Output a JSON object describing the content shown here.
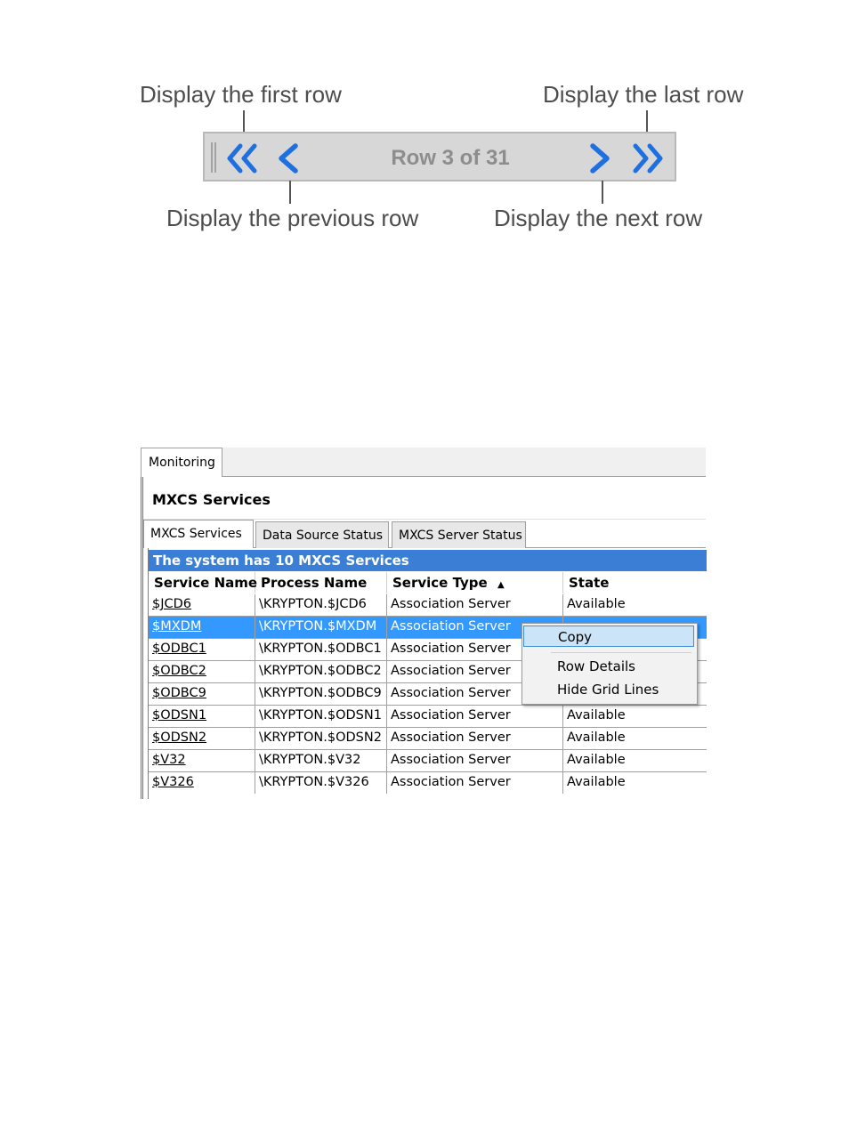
{
  "callouts": {
    "first": "Display the first row",
    "last": "Display the last row",
    "previous": "Display the previous row",
    "next": "Display the next row"
  },
  "navbar": {
    "status": "Row 3 of 31",
    "icons": [
      "first-row-icon",
      "previous-row-icon",
      "next-row-icon",
      "last-row-icon"
    ],
    "accent": "#1e6fe0"
  },
  "window": {
    "top_tab": "Monitoring",
    "panel_title": "MXCS Services",
    "subtabs": [
      "MXCS Services",
      "Data Source Status",
      "MXCS Server Status"
    ],
    "banner": "The system has 10 MXCS Services",
    "banner_color": "#3a7fd5",
    "columns": [
      "Service Name",
      "Process Name",
      "Service Type",
      "State"
    ],
    "sort_indicator": "▲",
    "rows": [
      {
        "service": "$JCD6",
        "process": "\\KRYPTON.$JCD6",
        "type": "Association Server",
        "state": "Available"
      },
      {
        "service": "$MXDM",
        "process": "\\KRYPTON.$MXDM",
        "type": "Association Server",
        "state": ""
      },
      {
        "service": "$ODBC1",
        "process": "\\KRYPTON.$ODBC1",
        "type": "Association Server",
        "state": ""
      },
      {
        "service": "$ODBC2",
        "process": "\\KRYPTON.$ODBC2",
        "type": "Association Server",
        "state": ""
      },
      {
        "service": "$ODBC9",
        "process": "\\KRYPTON.$ODBC9",
        "type": "Association Server",
        "state": ""
      },
      {
        "service": "$ODSN1",
        "process": "\\KRYPTON.$ODSN1",
        "type": "Association Server",
        "state": "Available"
      },
      {
        "service": "$ODSN2",
        "process": "\\KRYPTON.$ODSN2",
        "type": "Association Server",
        "state": "Available"
      },
      {
        "service": "$V32",
        "process": "\\KRYPTON.$V32",
        "type": "Association Server",
        "state": "Available"
      },
      {
        "service": "$V326",
        "process": "\\KRYPTON.$V326",
        "type": "Association Server",
        "state": "Available"
      }
    ],
    "selected_row_color": "#3399ff"
  },
  "context_menu": {
    "items": [
      "Copy",
      "Row Details",
      "Hide Grid Lines"
    ]
  }
}
